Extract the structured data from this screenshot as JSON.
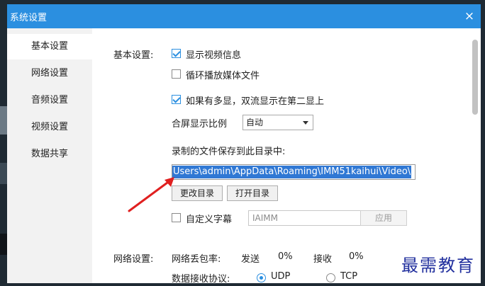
{
  "window": {
    "title": "系统设置",
    "close_glyph": "×"
  },
  "sidebar": {
    "items": [
      {
        "label": "基本设置",
        "active": true
      },
      {
        "label": "网络设置",
        "active": false
      },
      {
        "label": "音频设置",
        "active": false
      },
      {
        "label": "视频设置",
        "active": false
      },
      {
        "label": "数据共享",
        "active": false
      }
    ]
  },
  "basic": {
    "section_label": "基本设置:",
    "show_video_info": {
      "label": "显示视频信息",
      "checked": true
    },
    "loop_media": {
      "label": "循环播放媒体文件",
      "checked": false
    },
    "dual_screen": {
      "label": "如果有多显，双流显示在第二显上",
      "checked": true
    },
    "aspect_label": "合屏显示比例",
    "aspect_value": "自动",
    "record_dir_label": "录制的文件保存到此目录中:",
    "record_dir_path": "Users\\admin\\AppData\\Roaming\\IMM51kaihui\\Video\\",
    "change_dir_button": "更改目录",
    "open_dir_button": "打开目录",
    "custom_subtitle": {
      "label": "自定义字幕",
      "checked": false
    },
    "subtitle_value": "IAIMM",
    "apply_button": "应用"
  },
  "network": {
    "section_label": "网络设置:",
    "packet_loss_label": "网络丢包率:",
    "send_label": "发送",
    "send_value": "0%",
    "recv_label": "接收",
    "recv_value": "0%",
    "protocol_label": "数据接收协议:",
    "udp_label": "UDP",
    "tcp_label": "TCP",
    "selected_protocol": "UDP"
  },
  "watermark": {
    "text": "最需教育"
  },
  "colors": {
    "titlebar": "#2b8fe0",
    "selection": "#3078d4",
    "arrow": "#e02020",
    "watermark": "#22309e"
  }
}
